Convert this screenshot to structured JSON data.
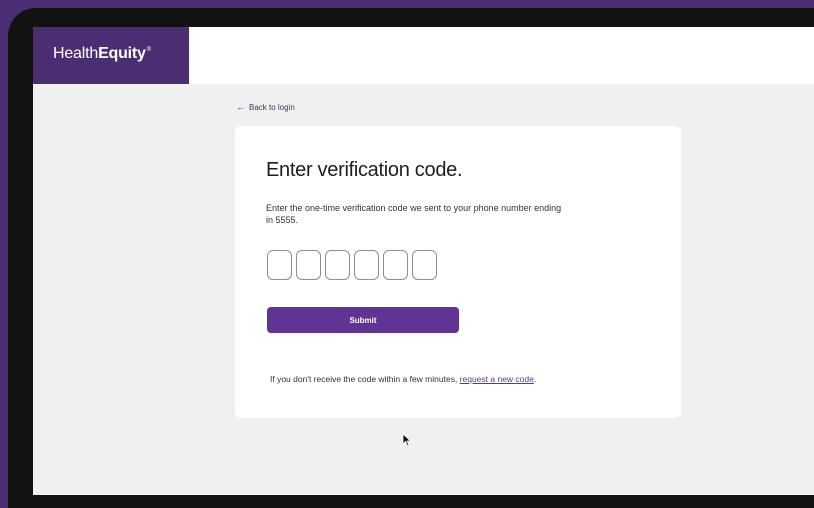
{
  "brand": {
    "name_light": "Health",
    "name_bold": "Equity",
    "trademark": "®",
    "color": "#4b2d73"
  },
  "nav": {
    "back_label": "Back to login",
    "back_icon": "arrow-left-icon"
  },
  "form": {
    "title": "Enter verification code.",
    "description": "Enter the one-time verification code we sent to your phone number ending in 5555.",
    "code_digits": [
      "",
      "",
      "",
      "",
      "",
      ""
    ],
    "submit_label": "Submit",
    "submit_color": "#5f3494",
    "help_prefix": "If you don't receive the code within a few minutes, ",
    "help_link": "request a new code",
    "help_suffix": "."
  },
  "cursor_icon": "mouse-pointer-icon"
}
